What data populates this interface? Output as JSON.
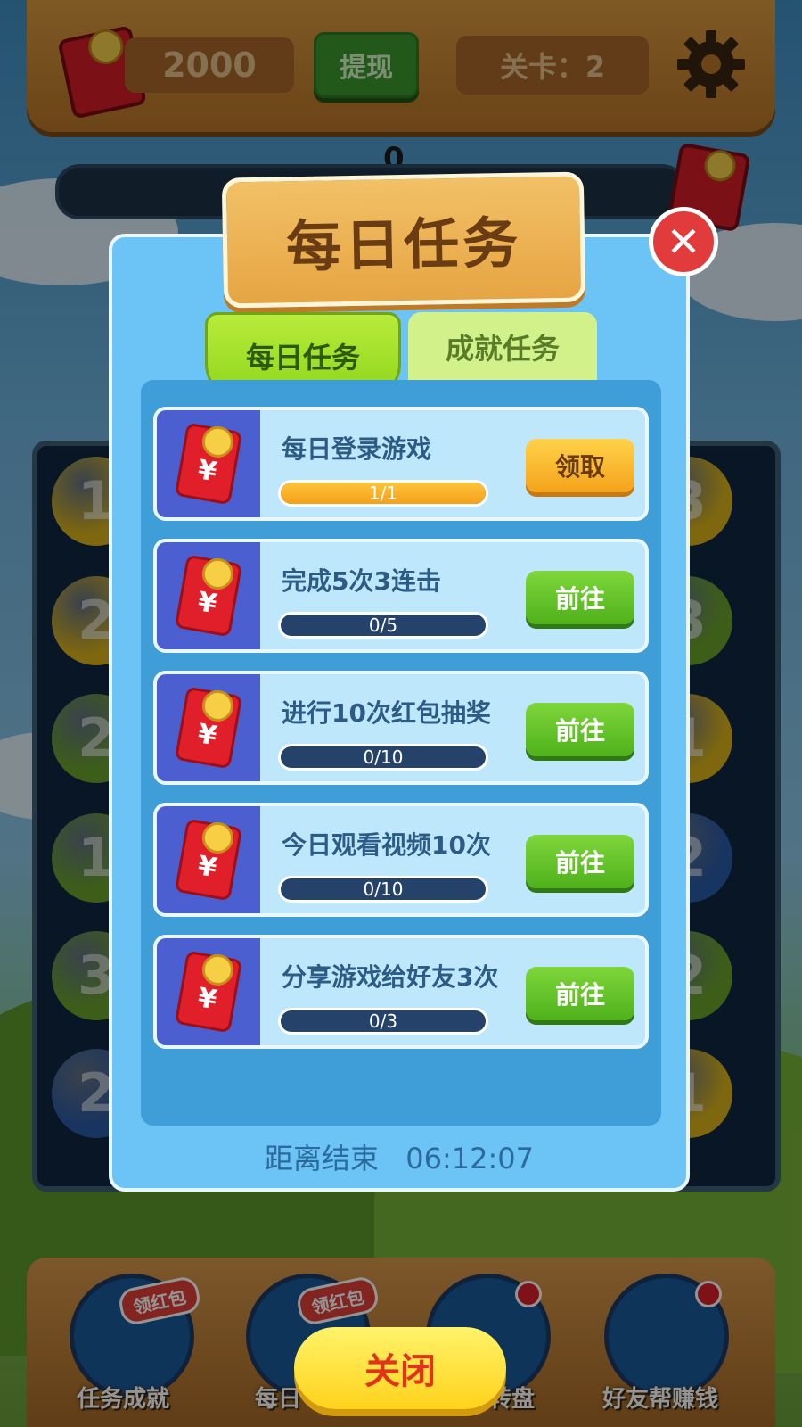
{
  "header": {
    "coins": "2000",
    "withdraw_label": "提现",
    "level_label": "关卡：2",
    "score": "0"
  },
  "board": {
    "balls": [
      {
        "n": "1",
        "color": "#d9b21a"
      },
      {
        "n": "3",
        "color": "#d9b21a"
      },
      {
        "n": "2",
        "color": "#d9b21a"
      },
      {
        "n": "3",
        "color": "#6aa32a"
      },
      {
        "n": "2",
        "color": "#6aa32a"
      },
      {
        "n": "1",
        "color": "#d9b21a"
      },
      {
        "n": "1",
        "color": "#6aa32a"
      },
      {
        "n": "2",
        "color": "#2a5aa6"
      },
      {
        "n": "3",
        "color": "#6aa32a"
      },
      {
        "n": "2",
        "color": "#6aa32a"
      },
      {
        "n": "2",
        "color": "#2a5aa6"
      },
      {
        "n": "1",
        "color": "#d9b21a"
      }
    ]
  },
  "bottom_nav": {
    "items": [
      {
        "label": "任务成就",
        "badge": "领红包"
      },
      {
        "label": "每日",
        "badge": "领红包"
      },
      {
        "label": "转盘",
        "badge": ""
      },
      {
        "label": "好友帮赚钱",
        "badge": ""
      }
    ]
  },
  "dialog": {
    "title": "每日任务",
    "tabs": [
      {
        "label": "每日任务",
        "active": true
      },
      {
        "label": "成就任务",
        "active": false
      }
    ],
    "tasks": [
      {
        "title": "每日登录游戏",
        "progress_text": "1/1",
        "progress": 1.0,
        "button": "领取",
        "button_type": "claim"
      },
      {
        "title": "完成5次3连击",
        "progress_text": "0/5",
        "progress": 0,
        "button": "前往",
        "button_type": "go"
      },
      {
        "title": "进行10次红包抽奖",
        "progress_text": "0/10",
        "progress": 0,
        "button": "前往",
        "button_type": "go"
      },
      {
        "title": "今日观看视频10次",
        "progress_text": "0/10",
        "progress": 0,
        "button": "前往",
        "button_type": "go"
      },
      {
        "title": "分享游戏给好友3次",
        "progress_text": "0/3",
        "progress": 0,
        "button": "前往",
        "button_type": "go"
      }
    ],
    "countdown_label": "距离结束",
    "countdown_time": "06:12:07",
    "close_button": "关闭"
  },
  "colors": {
    "dialog_bg": "#6bc3f6",
    "go_button": "#4fb11b",
    "claim_button": "#f4a31b",
    "icon_bg": "#4b5fd1"
  }
}
